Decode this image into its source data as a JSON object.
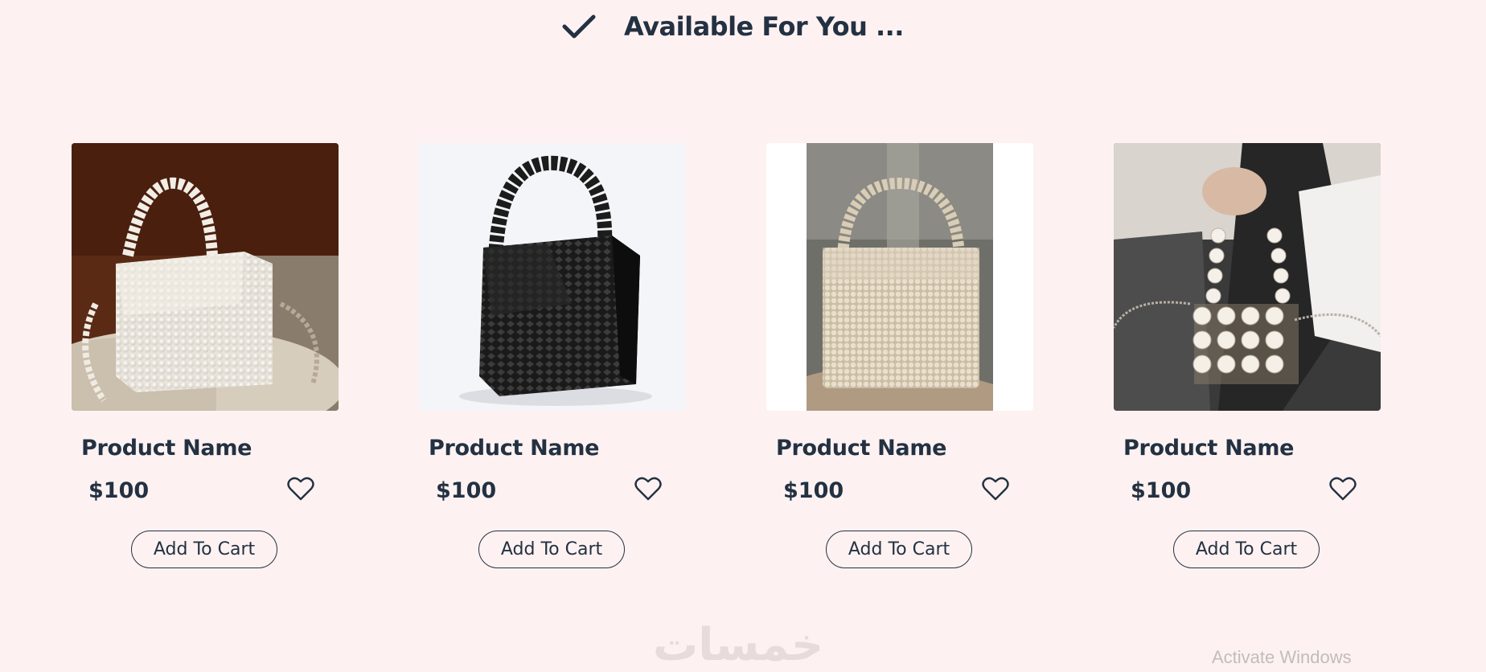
{
  "section": {
    "title": "Available For You ...",
    "icon": "check-icon"
  },
  "products": [
    {
      "name": "Product Name",
      "price": "$100",
      "cart_label": "Add To Cart",
      "image": "white-pearl-bag"
    },
    {
      "name": "Product Name",
      "price": "$100",
      "cart_label": "Add To Cart",
      "image": "black-beaded-bag"
    },
    {
      "name": "Product Name",
      "price": "$100",
      "cart_label": "Add To Cart",
      "image": "champagne-pearl-bag"
    },
    {
      "name": "Product Name",
      "price": "$100",
      "cart_label": "Add To Cart",
      "image": "pearl-chain-bag"
    }
  ],
  "watermark": "خمسات",
  "os_notice": "Activate Windows",
  "colors": {
    "background": "#fdf2f1",
    "text": "#233142",
    "border": "#233142"
  }
}
